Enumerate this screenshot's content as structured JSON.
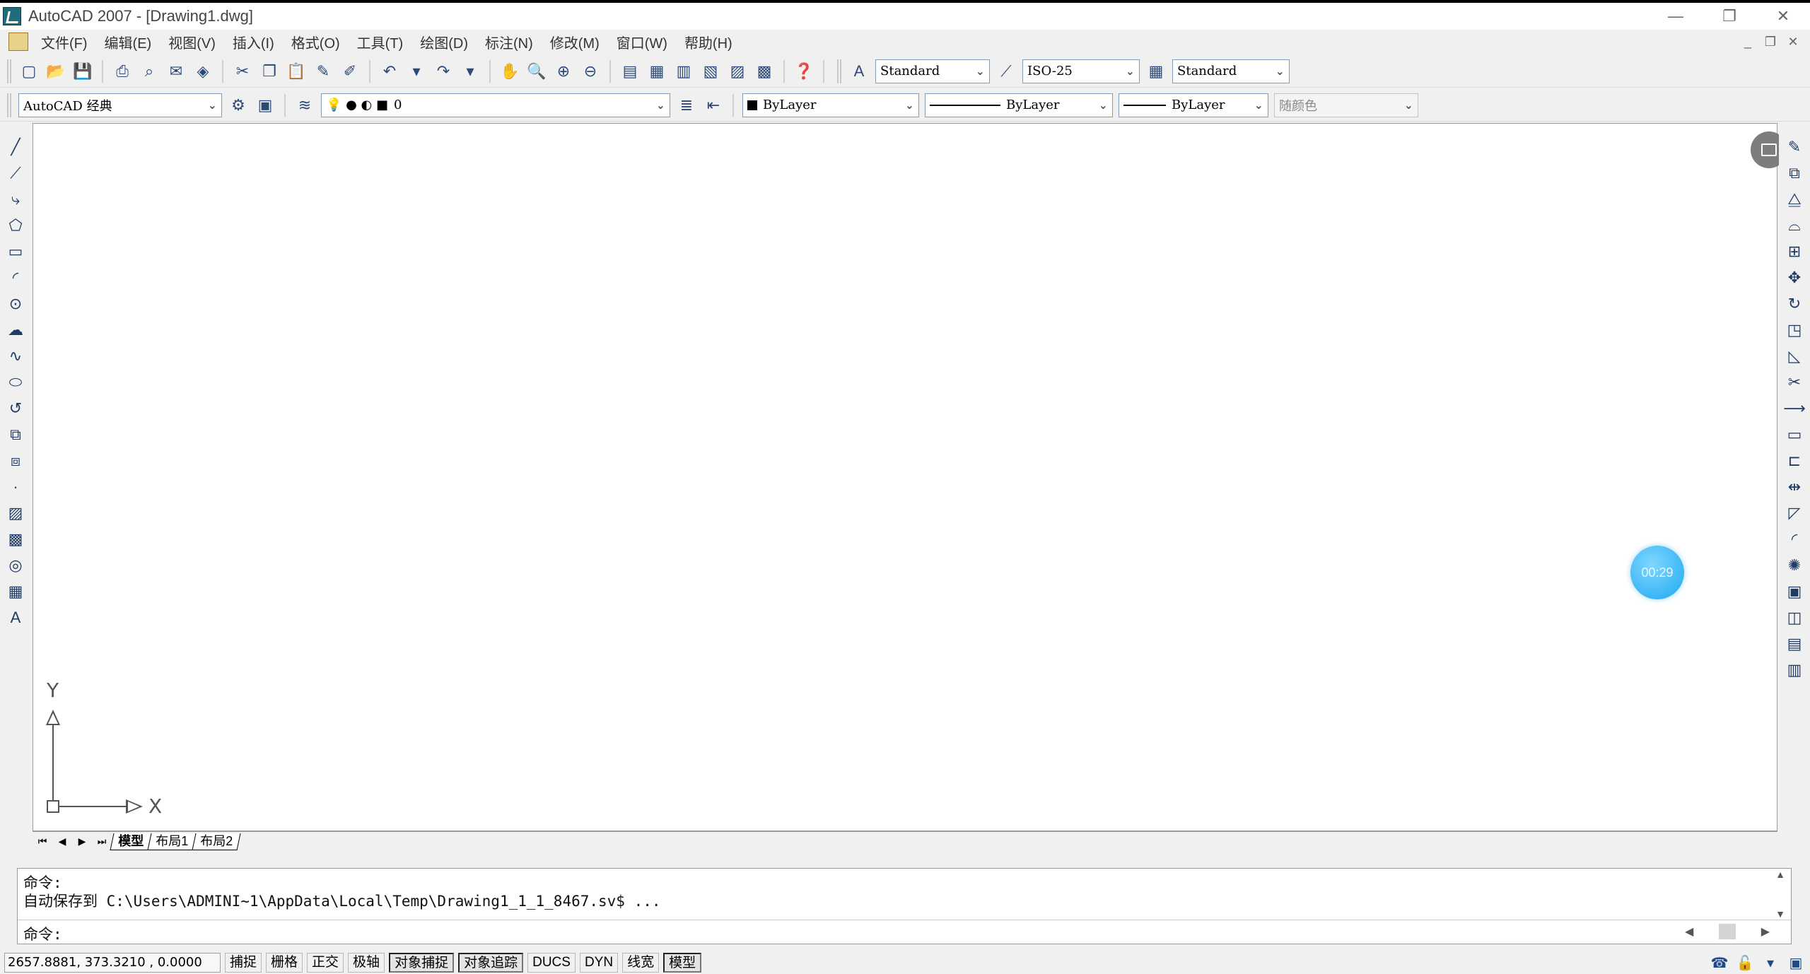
{
  "window": {
    "title": "AutoCAD 2007 - [Drawing1.dwg]",
    "controls": [
      "—",
      "❐",
      "✕"
    ]
  },
  "menu": {
    "items": [
      "文件(F)",
      "编辑(E)",
      "视图(V)",
      "插入(I)",
      "格式(O)",
      "工具(T)",
      "绘图(D)",
      "标注(N)",
      "修改(M)",
      "窗口(W)",
      "帮助(H)"
    ],
    "mdi_controls": [
      "_",
      "❐",
      "✕"
    ]
  },
  "toolbar1": {
    "text_style": "Standard",
    "dim_style": "ISO-25",
    "table_style": "Standard"
  },
  "toolbar2": {
    "workspace": "AutoCAD 经典",
    "layer": "0",
    "color": "ByLayer",
    "linetype": "ByLayer",
    "lineweight": "ByLayer",
    "plot_style": "随颜色"
  },
  "ucs": {
    "x_label": "X",
    "y_label": "Y"
  },
  "timer": "00:29",
  "tabs": [
    "模型",
    "布局1",
    "布局2"
  ],
  "command": {
    "history": [
      "命令:",
      "自动保存到 C:\\Users\\ADMINI~1\\AppData\\Local\\Temp\\Drawing1_1_1_8467.sv$ ..."
    ],
    "prompt": "命令:"
  },
  "status": {
    "coords": "2657.8881, 373.3210 , 0.0000",
    "toggles": [
      {
        "label": "捕捉",
        "on": false
      },
      {
        "label": "栅格",
        "on": false
      },
      {
        "label": "正交",
        "on": false
      },
      {
        "label": "极轴",
        "on": false
      },
      {
        "label": "对象捕捉",
        "on": true
      },
      {
        "label": "对象追踪",
        "on": true
      },
      {
        "label": "DUCS",
        "on": false
      },
      {
        "label": "DYN",
        "on": false
      },
      {
        "label": "线宽",
        "on": false
      },
      {
        "label": "模型",
        "on": true
      }
    ]
  },
  "colors": {
    "canvas": "#ffffff",
    "chrome": "#f0f0f0",
    "timer": "#1ea8f0"
  }
}
